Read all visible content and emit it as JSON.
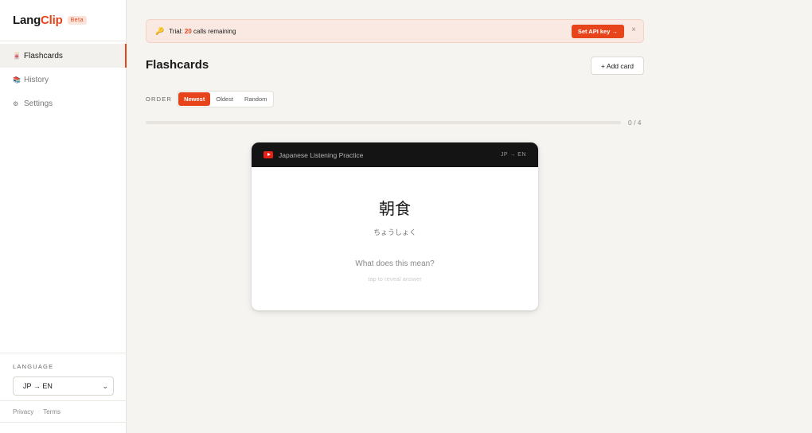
{
  "brand": {
    "lang": "Lang",
    "clip": "Clip",
    "badge": "Beta"
  },
  "nav": [
    {
      "label": "Flashcards",
      "icon": "cards-icon",
      "glyph": "🀄",
      "active": true
    },
    {
      "label": "History",
      "icon": "history-icon",
      "glyph": "📚",
      "active": false
    },
    {
      "label": "Settings",
      "icon": "gear-icon",
      "glyph": "⚙",
      "active": false
    }
  ],
  "language": {
    "label": "LANGUAGE",
    "value": "JP → EN"
  },
  "footer": {
    "privacy": "Privacy",
    "terms": "Terms"
  },
  "banner": {
    "prefix": "Trial: ",
    "count": "20",
    "suffix": " calls remaining",
    "api_button": "Set API key →",
    "close": "×"
  },
  "page": {
    "title": "Flashcards",
    "add_button": "+ Add card"
  },
  "order": {
    "label": "ORDER",
    "options": [
      {
        "label": "Newest",
        "active": true
      },
      {
        "label": "Oldest",
        "active": false
      },
      {
        "label": "Random",
        "active": false
      }
    ]
  },
  "progress": {
    "text": "0 / 4",
    "current": 0,
    "total": 4
  },
  "card": {
    "source": "Japanese Listening Practice",
    "direction": "JP → EN",
    "word": "朝食",
    "reading": "ちょうしょく",
    "question": "What does this mean?",
    "hint": "tap to reveal answer"
  },
  "colors": {
    "accent": "#e8441c",
    "card_header": "#141414",
    "background": "#f6f4f1"
  }
}
